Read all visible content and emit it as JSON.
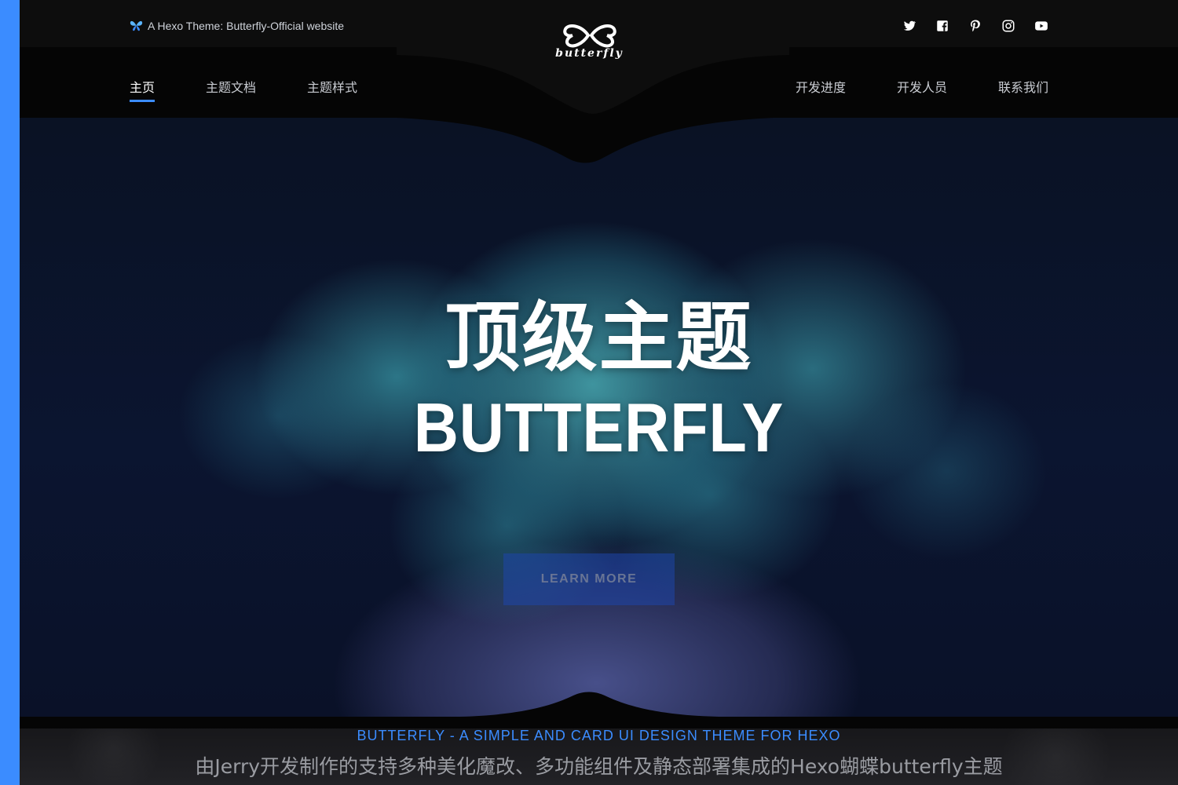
{
  "colors": {
    "accent": "#3b8cff",
    "header_bg": "#0d0d0d",
    "nav_bg": "#050505",
    "footer_bg": "#1e1e22"
  },
  "topbar": {
    "tagline_icon": "butterfly-icon",
    "tagline": "A Hexo Theme: Butterfly-Official website",
    "logo_text": "butterfly",
    "socials": [
      {
        "name": "twitter-icon"
      },
      {
        "name": "facebook-icon"
      },
      {
        "name": "pinterest-icon"
      },
      {
        "name": "instagram-icon"
      },
      {
        "name": "youtube-icon"
      }
    ]
  },
  "nav": {
    "left": [
      {
        "label": "主页",
        "active": true
      },
      {
        "label": "主题文档",
        "active": false
      },
      {
        "label": "主题样式",
        "active": false
      }
    ],
    "right": [
      {
        "label": "开发进度"
      },
      {
        "label": "开发人员"
      },
      {
        "label": "联系我们"
      }
    ]
  },
  "hero": {
    "title": "顶级主题",
    "subtitle": "BUTTERFLY",
    "button_label": "LEARN MORE",
    "slides": {
      "count": 3,
      "active": 1
    }
  },
  "footer": {
    "eyebrow": "BUTTERFLY - A SIMPLE AND CARD UI DESIGN THEME FOR HEXO",
    "description": "由Jerry开发制作的支持多种美化魔改、多功能组件及静态部署集成的Hexo蝴蝶butterfly主题"
  }
}
